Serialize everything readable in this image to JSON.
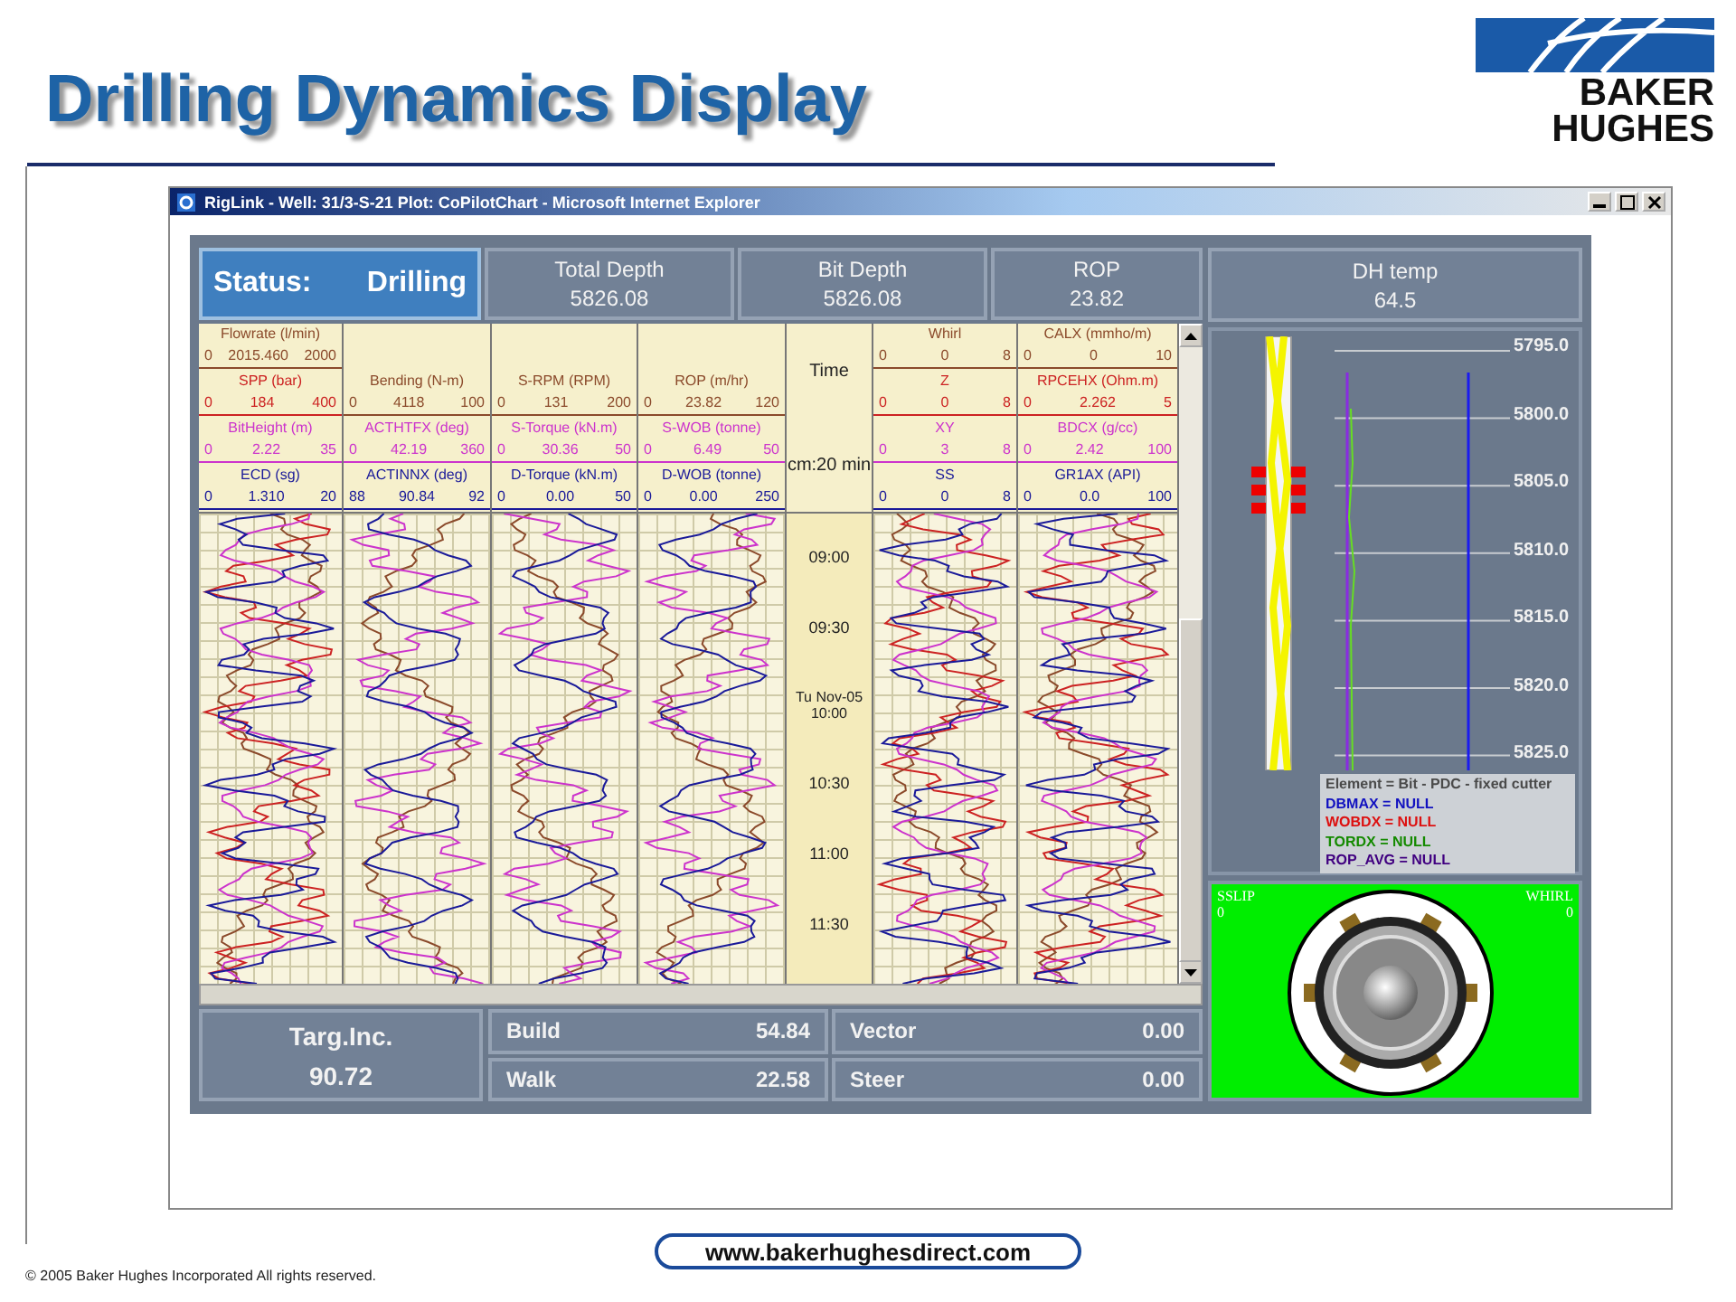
{
  "slide": {
    "title": "Drilling Dynamics Display",
    "logo": [
      "BAKER",
      "HUGHES"
    ],
    "copyright": "© 2005 Baker Hughes Incorporated All rights reserved.",
    "url": "www.bakerhughesdirect.com"
  },
  "window": {
    "title": "RigLink - Well: 31/3-S-21 Plot: CoPilotChart - Microsoft Internet Explorer"
  },
  "status": {
    "label": "Status:",
    "value": "Drilling"
  },
  "readouts": [
    {
      "label": "Total Depth",
      "value": "5826.08"
    },
    {
      "label": "Bit Depth",
      "value": "5826.08"
    },
    {
      "label": "ROP",
      "value": "23.82"
    }
  ],
  "side_readout": {
    "label": "DH temp",
    "value": "64.5"
  },
  "tracks": [
    {
      "kind": "curves",
      "curves": [
        {
          "name": "Flowrate (l/min)",
          "min": "0",
          "value": "2015.460",
          "max": "2000",
          "color": "#8b4a2b"
        },
        {
          "name": "SPP (bar)",
          "min": "0",
          "value": "184",
          "max": "400",
          "color": "#cc2222"
        },
        {
          "name": "BitHeight (m)",
          "min": "0",
          "value": "2.22",
          "max": "35",
          "color": "#cc33cc"
        },
        {
          "name": "ECD (sg)",
          "min": "0",
          "value": "1.310",
          "max": "20",
          "color": "#1a1a99"
        }
      ]
    },
    {
      "kind": "curves",
      "curves": [
        {
          "name": "Bending (N-m)",
          "min": "0",
          "value": "4118",
          "max": "100",
          "color": "#8b4a2b"
        },
        {
          "name": "ACTHTFX (deg)",
          "min": "0",
          "value": "42.19",
          "max": "360",
          "color": "#cc33cc"
        },
        {
          "name": "ACTINNX (deg)",
          "min": "88",
          "value": "90.84",
          "max": "92",
          "color": "#1a1a99"
        }
      ]
    },
    {
      "kind": "curves",
      "curves": [
        {
          "name": "S-RPM (RPM)",
          "min": "0",
          "value": "131",
          "max": "200",
          "color": "#8b4a2b"
        },
        {
          "name": "S-Torque (kN.m)",
          "min": "0",
          "value": "30.36",
          "max": "50",
          "color": "#cc33cc"
        },
        {
          "name": "D-Torque (kN.m)",
          "min": "0",
          "value": "0.00",
          "max": "50",
          "color": "#1a1a99"
        }
      ]
    },
    {
      "kind": "curves",
      "curves": [
        {
          "name": "ROP (m/hr)",
          "min": "0",
          "value": "23.82",
          "max": "120",
          "color": "#8b4a2b"
        },
        {
          "name": "S-WOB (tonne)",
          "min": "0",
          "value": "6.49",
          "max": "50",
          "color": "#cc33cc"
        },
        {
          "name": "D-WOB (tonne)",
          "min": "0",
          "value": "0.00",
          "max": "250",
          "color": "#1a1a99"
        }
      ]
    },
    {
      "kind": "time",
      "title": "Time",
      "scale": "cm:20 min",
      "labels": [
        "09:00",
        "09:30",
        "Tu Nov-05 10:00",
        "10:30",
        "11:00",
        "11:30"
      ]
    },
    {
      "kind": "curves",
      "curves": [
        {
          "name": "Whirl",
          "min": "0",
          "value": "0",
          "max": "8",
          "color": "#8b4a2b"
        },
        {
          "name": "Z",
          "min": "0",
          "value": "0",
          "max": "8",
          "color": "#cc2222"
        },
        {
          "name": "XY",
          "min": "0",
          "value": "3",
          "max": "8",
          "color": "#cc33cc"
        },
        {
          "name": "SS",
          "min": "0",
          "value": "0",
          "max": "8",
          "color": "#1a1a99"
        }
      ]
    },
    {
      "kind": "curves",
      "curves": [
        {
          "name": "CALX (mmho/m)",
          "min": "0",
          "value": "0",
          "max": "10",
          "color": "#8b4a2b"
        },
        {
          "name": "RPCEHX (Ohm.m)",
          "min": "0",
          "value": "2.262",
          "max": "5",
          "color": "#cc2222"
        },
        {
          "name": "BDCX (g/cc)",
          "min": "0",
          "value": "2.42",
          "max": "100",
          "color": "#cc33cc"
        },
        {
          "name": "GR1AX (API)",
          "min": "0",
          "value": "0.0",
          "max": "100",
          "color": "#1a1a99"
        }
      ]
    }
  ],
  "depth_panel": {
    "depths": [
      "5795.0",
      "5800.0",
      "5805.0",
      "5810.0",
      "5815.0",
      "5820.0",
      "5825.0"
    ],
    "legend": [
      {
        "text": "Element = Bit - PDC - fixed cutter",
        "color": "#4a4a4a"
      },
      {
        "text": "DBMAX = NULL",
        "color": "#1010c0"
      },
      {
        "text": "WOBDX = NULL",
        "color": "#dd1010"
      },
      {
        "text": "TORDX = NULL",
        "color": "#148a00"
      },
      {
        "text": "ROP_AVG = NULL",
        "color": "#400080"
      }
    ]
  },
  "vibration_panel": {
    "left_label": "SSLIP",
    "left_value": "0",
    "right_label": "WHIRL",
    "right_value": "0"
  },
  "target": {
    "label": "Targ.Inc.",
    "value": "90.72"
  },
  "directional": [
    {
      "label": "Build",
      "value": "54.84"
    },
    {
      "label": "Walk",
      "value": "22.58"
    },
    {
      "label": "Vector",
      "value": "0.00"
    },
    {
      "label": "Steer",
      "value": "0.00"
    }
  ]
}
